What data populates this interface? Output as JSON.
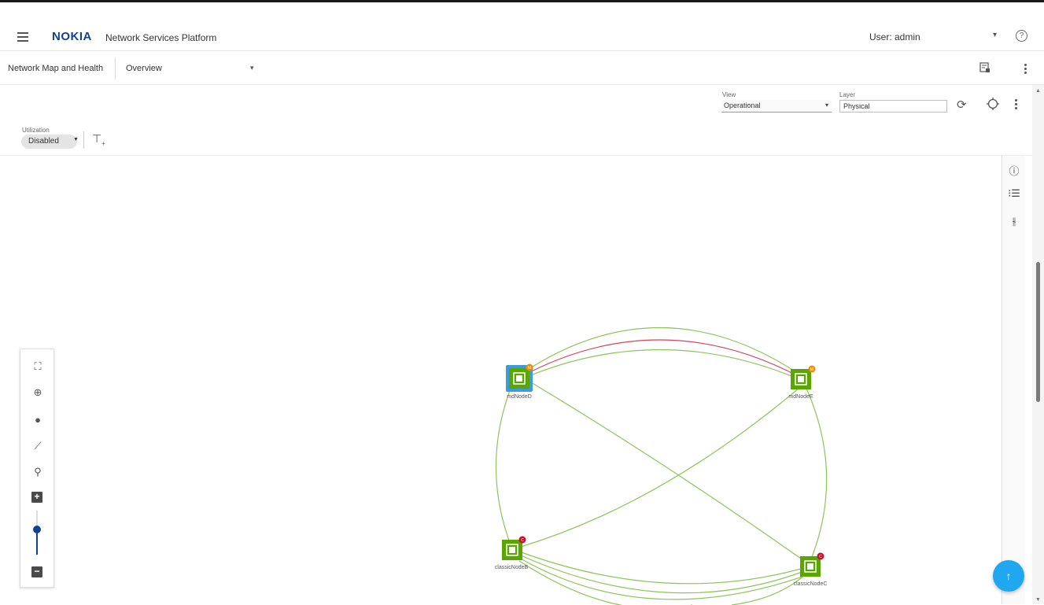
{
  "header": {
    "logo": "NOKIA",
    "app_title": "Network Services Platform",
    "user": "User: admin"
  },
  "subheader": {
    "breadcrumb": "Network Map and Health",
    "page": "Overview"
  },
  "controls": {
    "view_label": "View",
    "view_value": "Operational",
    "layer_label": "Layer",
    "layer_value": "Physical",
    "utilization_label": "Utilization",
    "utilization_value": "Disabled"
  },
  "map": {
    "nodes": [
      {
        "id": "mdNodeD",
        "label": "mdNodeD",
        "badge": "M",
        "badge_color": "#f08c00",
        "selected": true
      },
      {
        "id": "mdNodeE",
        "label": "mdNodeE",
        "badge": "M",
        "badge_color": "#f08c00",
        "selected": false
      },
      {
        "id": "classicNodeB",
        "label": "classicNodeB",
        "badge": "C",
        "badge_color": "#c8102e",
        "selected": false
      },
      {
        "id": "classicNodeC",
        "label": "classicNodeC",
        "badge": "C",
        "badge_color": "#c8102e",
        "selected": false
      }
    ],
    "node_color": "#5aa500",
    "link_color": "#8cc45a",
    "alarm_link_color": "#d0455e"
  },
  "icons": {
    "menu": "hamburger-icon",
    "help": "help-icon",
    "report": "report-icon",
    "refresh": "refresh-icon",
    "target": "crosshair-icon",
    "filter": "filter-add-icon",
    "info": "info-icon",
    "list": "list-icon",
    "settings": "sliders-icon",
    "scroll_top": "arrow-up-icon"
  }
}
